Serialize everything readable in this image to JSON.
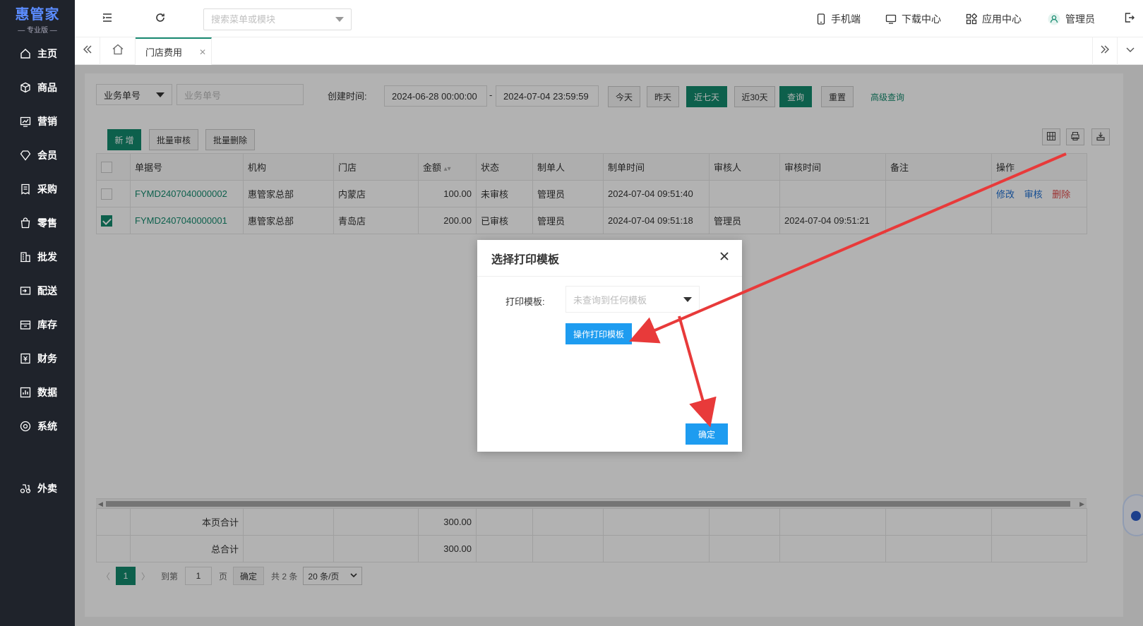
{
  "brand": {
    "name": "惠管家",
    "edition": "— 专业版 —"
  },
  "sidebar": {
    "items": [
      {
        "label": "主页",
        "icon": "home-icon"
      },
      {
        "label": "商品",
        "icon": "box-icon"
      },
      {
        "label": "营销",
        "icon": "chart-icon"
      },
      {
        "label": "会员",
        "icon": "diamond-icon"
      },
      {
        "label": "采购",
        "icon": "receipt-icon"
      },
      {
        "label": "零售",
        "icon": "bag-icon"
      },
      {
        "label": "批发",
        "icon": "building-icon"
      },
      {
        "label": "配送",
        "icon": "delivery-icon"
      },
      {
        "label": "库存",
        "icon": "inventory-icon"
      },
      {
        "label": "财务",
        "icon": "finance-icon"
      },
      {
        "label": "数据",
        "icon": "data-icon"
      },
      {
        "label": "系统",
        "icon": "settings-icon"
      }
    ],
    "extra": {
      "label": "外卖",
      "icon": "takeout-icon"
    }
  },
  "header": {
    "search_placeholder": "搜索菜单或模块",
    "mobile": "手机端",
    "download": "下载中心",
    "apps": "应用中心",
    "user": "管理员"
  },
  "tabs": {
    "active": "门店费用"
  },
  "filters": {
    "field_select": "业务单号",
    "field_placeholder": "业务单号",
    "date_label": "创建时间:",
    "date_start": "2024-06-28 00:00:00",
    "date_sep": "-",
    "date_end": "2024-07-04 23:59:59",
    "quick": [
      "今天",
      "昨天",
      "近七天",
      "近30天"
    ],
    "query": "查询",
    "reset": "重置",
    "advanced": "高级查询"
  },
  "toolbar": {
    "add": "新 增",
    "batch_audit": "批量审核",
    "batch_delete": "批量删除"
  },
  "table": {
    "columns": [
      "单据号",
      "机构",
      "门店",
      "金额",
      "状态",
      "制单人",
      "制单时间",
      "审核人",
      "审核时间",
      "备注",
      "操作"
    ],
    "rows": [
      {
        "checked": false,
        "no": "FYMD2407040000002",
        "org": "惠管家总部",
        "store": "内蒙店",
        "amount": "100.00",
        "status": "未审核",
        "maker": "管理员",
        "made_at": "2024-07-04 09:51:40",
        "auditor": "",
        "audited_at": "",
        "remark": "",
        "ops": [
          "修改",
          "审核",
          "删除"
        ]
      },
      {
        "checked": true,
        "no": "FYMD2407040000001",
        "org": "惠管家总部",
        "store": "青岛店",
        "amount": "200.00",
        "status": "已审核",
        "maker": "管理员",
        "made_at": "2024-07-04 09:51:18",
        "auditor": "管理员",
        "audited_at": "2024-07-04 09:51:21",
        "remark": "",
        "ops": []
      }
    ]
  },
  "summary": {
    "page_label": "本页合计",
    "page_amount": "300.00",
    "total_label": "总合计",
    "total_amount": "300.00"
  },
  "pager": {
    "current": "1",
    "goto_label": "到第",
    "goto_value": "1",
    "page_unit": "页",
    "ok": "确定",
    "total": "共 2 条",
    "size": "20 条/页"
  },
  "modal": {
    "title": "选择打印模板",
    "label": "打印模板:",
    "select_placeholder": "未查询到任何模板",
    "template_button": "操作打印模板",
    "ok_button": "确定"
  },
  "colors": {
    "accent": "#148a6e",
    "primary_blue": "#1e9cf0",
    "sidebar_bg": "#1f232b",
    "annotation_red": "#e83a3a"
  }
}
